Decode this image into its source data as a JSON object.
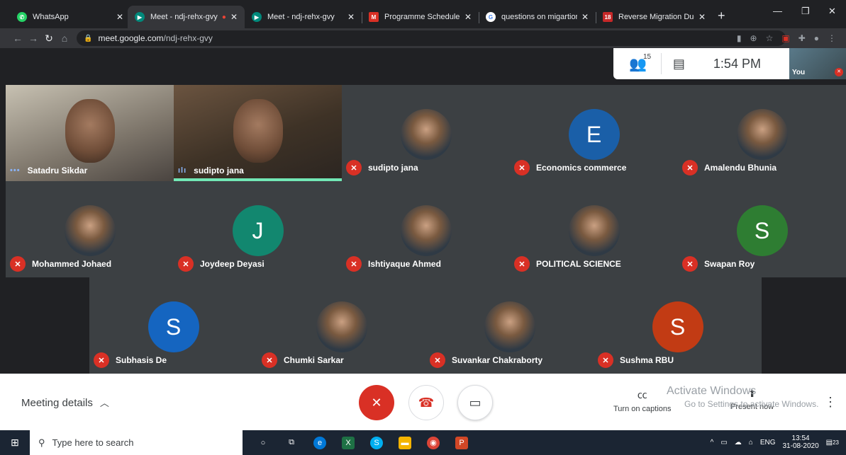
{
  "browser": {
    "tabs": [
      {
        "title": "WhatsApp",
        "icon": "whatsapp-icon",
        "color": "#25d366"
      },
      {
        "title": "Meet - ndj-rehx-gvy",
        "icon": "meet-icon",
        "color": "#00897b",
        "recording": true
      },
      {
        "title": "Meet - ndj-rehx-gvy",
        "icon": "meet-icon",
        "color": "#00897b"
      },
      {
        "title": "Programme Schedule a",
        "icon": "gmail-icon",
        "color": "#d93025"
      },
      {
        "title": "questions on migartion",
        "icon": "google-icon",
        "color": "#4285f4"
      },
      {
        "title": "Reverse Migration Due",
        "icon": "news18-icon",
        "color": "#c62828",
        "badge": "18"
      }
    ],
    "url_domain": "meet.google.com",
    "url_path": "/ndj-rehx-gvy"
  },
  "meeting": {
    "participant_count": "15",
    "time": "1:54 PM",
    "self_label": "You",
    "details_label": "Meeting details",
    "captions_label": "Turn on captions",
    "present_label": "Present now",
    "activate_title": "Activate Windows",
    "activate_sub": "Go to Settings to activate Windows."
  },
  "participants": [
    {
      "name": "Satadru Sikdar",
      "type": "video",
      "muted": false
    },
    {
      "name": "sudipto jana",
      "type": "video",
      "muted": false,
      "speaking": true
    },
    {
      "name": "sudipto jana",
      "type": "photo",
      "muted": true
    },
    {
      "name": "Economics commerce",
      "type": "letter",
      "letter": "E",
      "color": "#1a5fa8",
      "muted": true
    },
    {
      "name": "Amalendu Bhunia",
      "type": "photo",
      "muted": true
    },
    {
      "name": "Mohammed Johaed",
      "type": "photo",
      "muted": true
    },
    {
      "name": "Joydeep Deyasi",
      "type": "letter",
      "letter": "J",
      "color": "#12876f",
      "muted": true
    },
    {
      "name": "Ishtiyaque Ahmed",
      "type": "photo",
      "muted": true
    },
    {
      "name": "POLITICAL SCIENCE",
      "type": "photo",
      "muted": true
    },
    {
      "name": "Swapan Roy",
      "type": "letter",
      "letter": "S",
      "color": "#2e7d32",
      "muted": true
    },
    {
      "name": "Subhasis De",
      "type": "letter",
      "letter": "S",
      "color": "#1565c0",
      "muted": true
    },
    {
      "name": "Chumki Sarkar",
      "type": "photo",
      "muted": true
    },
    {
      "name": "Suvankar Chakraborty",
      "type": "photo",
      "muted": true
    },
    {
      "name": "Sushma RBU",
      "type": "letter",
      "letter": "S",
      "color": "#c23b14",
      "muted": true
    }
  ],
  "taskbar": {
    "search_placeholder": "Type here to search",
    "lang": "ENG",
    "time": "13:54",
    "date": "31-08-2020",
    "notifications": "23"
  }
}
